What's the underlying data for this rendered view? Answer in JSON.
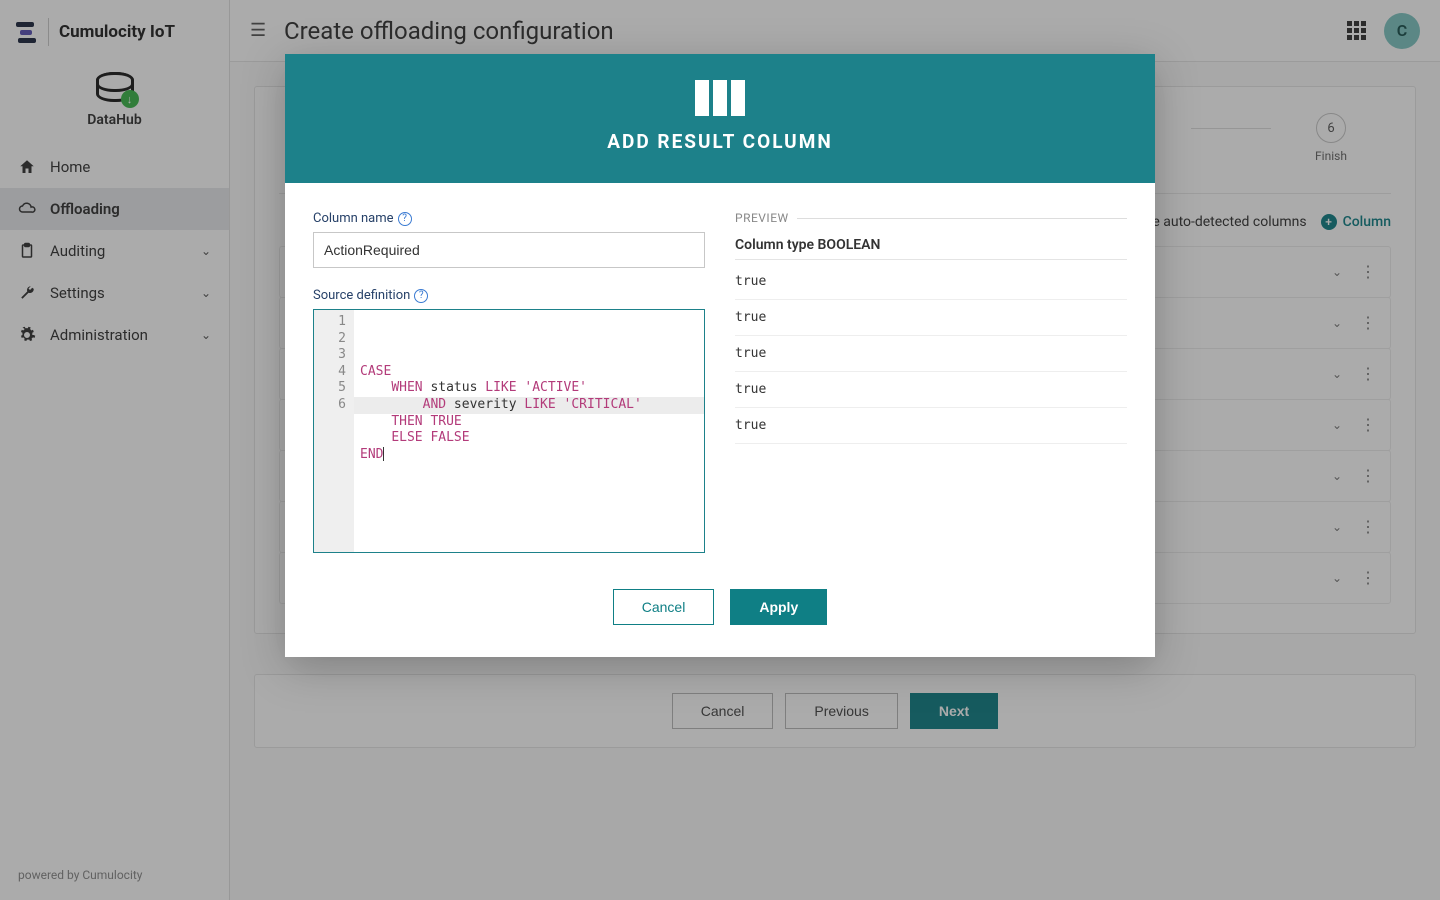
{
  "brand": {
    "name": "Cumulocity IoT",
    "subbrand": "DataHub"
  },
  "sidebar": {
    "items": [
      {
        "label": "Home"
      },
      {
        "label": "Offloading"
      },
      {
        "label": "Auditing"
      },
      {
        "label": "Settings"
      },
      {
        "label": "Administration"
      }
    ],
    "footer": "powered by Cumulocity"
  },
  "header": {
    "title": "Create offloading configuration",
    "avatar_initial": "C"
  },
  "stepper": {
    "steps": [
      {
        "num": "6",
        "label": "Finish"
      }
    ]
  },
  "columns_bar": {
    "hide_label": "Hide auto-detected columns",
    "add_label": "Column"
  },
  "column_rows_count": 7,
  "page_actions": {
    "cancel": "Cancel",
    "previous": "Previous",
    "next": "Next"
  },
  "modal": {
    "title": "ADD RESULT COLUMN",
    "column_name_label": "Column name",
    "column_name_value": "ActionRequired",
    "source_def_label": "Source definition",
    "code_lines": [
      [
        {
          "t": "CASE",
          "c": "kw"
        }
      ],
      [
        {
          "t": "    ",
          "c": ""
        },
        {
          "t": "WHEN",
          "c": "kw"
        },
        {
          "t": " status ",
          "c": ""
        },
        {
          "t": "LIKE",
          "c": "kw"
        },
        {
          "t": " ",
          "c": ""
        },
        {
          "t": "'ACTIVE'",
          "c": "str"
        }
      ],
      [
        {
          "t": "        ",
          "c": ""
        },
        {
          "t": "AND",
          "c": "kw"
        },
        {
          "t": " severity ",
          "c": ""
        },
        {
          "t": "LIKE",
          "c": "kw"
        },
        {
          "t": " ",
          "c": ""
        },
        {
          "t": "'CRITICAL'",
          "c": "str"
        }
      ],
      [
        {
          "t": "    ",
          "c": ""
        },
        {
          "t": "THEN",
          "c": "kw"
        },
        {
          "t": " ",
          "c": ""
        },
        {
          "t": "TRUE",
          "c": "bf"
        }
      ],
      [
        {
          "t": "    ",
          "c": ""
        },
        {
          "t": "ELSE",
          "c": "kw"
        },
        {
          "t": " ",
          "c": ""
        },
        {
          "t": "FALSE",
          "c": "bf"
        }
      ],
      [
        {
          "t": "END",
          "c": "kw"
        }
      ]
    ],
    "preview_label": "PREVIEW",
    "column_type": "Column type BOOLEAN",
    "preview_rows": [
      "true",
      "true",
      "true",
      "true",
      "true"
    ],
    "cancel": "Cancel",
    "apply": "Apply"
  }
}
